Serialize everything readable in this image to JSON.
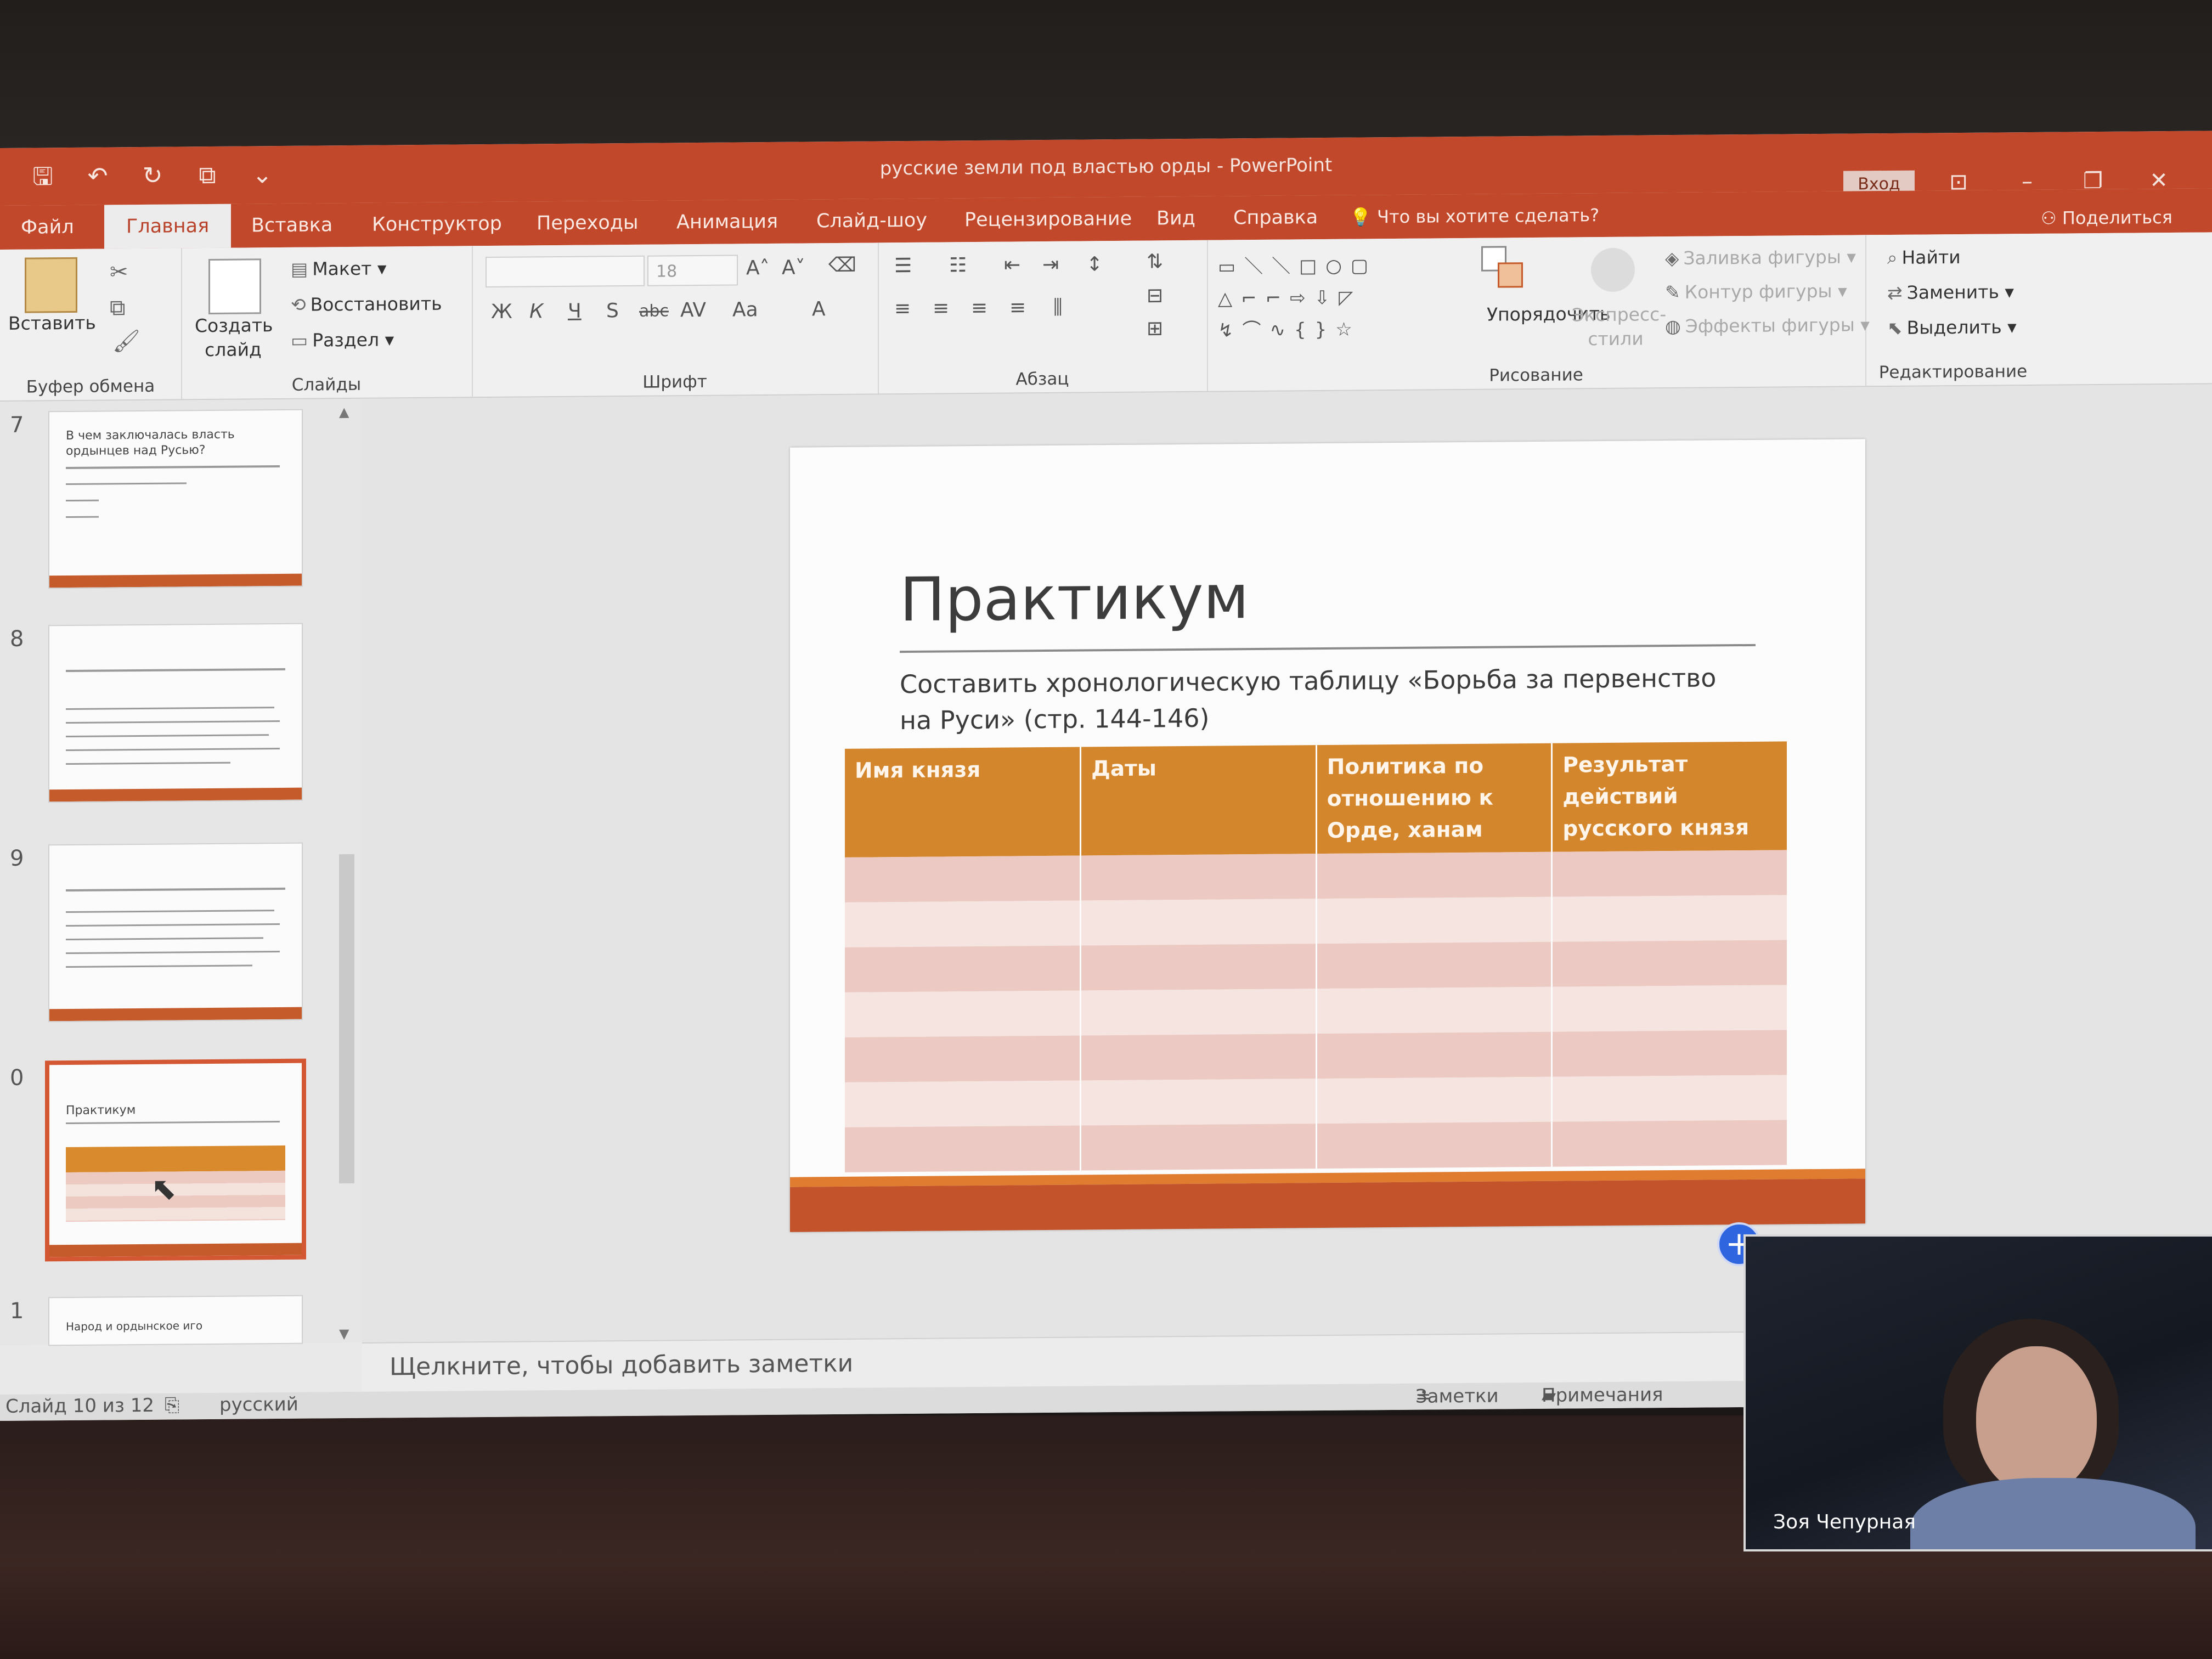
{
  "window": {
    "title": "русские земли под властью орды",
    "separator": "-",
    "app": "PowerPoint",
    "login": "Вход"
  },
  "qat": [
    "save-icon",
    "undo-icon",
    "redo-icon",
    "present-icon",
    "customize-icon"
  ],
  "tabs": [
    "Файл",
    "Главная",
    "Вставка",
    "Конструктор",
    "Переходы",
    "Анимация",
    "Слайд-шоу",
    "Рецензирование",
    "Вид",
    "Справка"
  ],
  "active_tab": "Главная",
  "tell_me": "Что вы хотите сделать?",
  "share": "Поделиться",
  "ribbon": {
    "clipboard": {
      "paste": "Вставить",
      "label": "Буфер обмена"
    },
    "slides": {
      "new_slide": "Создать слайд",
      "layout": "Макет",
      "reset": "Восстановить",
      "section": "Раздел",
      "label": "Слайды"
    },
    "font": {
      "font_name": "",
      "font_size": "18",
      "label": "Шрифт",
      "bold": "Ж",
      "italic": "К",
      "underline": "Ч",
      "shadow": "S",
      "strike": "abc",
      "spacing": "AV",
      "case": "Аа",
      "color": "A"
    },
    "paragraph": {
      "label": "Абзац"
    },
    "drawing": {
      "arrange": "Упорядочить",
      "quick_styles": "Экспресс-стили",
      "fill": "Заливка фигуры",
      "outline": "Контур фигуры",
      "effects": "Эффекты фигуры",
      "label": "Рисование"
    },
    "editing": {
      "find": "Найти",
      "replace": "Заменить",
      "select": "Выделить",
      "label": "Редактирование"
    }
  },
  "thumbnails": [
    {
      "num": "7",
      "title": "В чем заключалась власть ордынцев над Русью?"
    },
    {
      "num": "8",
      "title": ""
    },
    {
      "num": "9",
      "title": ""
    },
    {
      "num": "0",
      "title": "Практикум"
    },
    {
      "num": "1",
      "title": "Народ и ордынское иго"
    }
  ],
  "slide": {
    "title": "Практикум",
    "subtitle": "Составить хронологическую таблицу «Борьба за первенство на Руси» (стр. 144-146)",
    "table_headers": [
      "Имя князя",
      "Даты",
      "Политика по отношению к Орде, ханам",
      "Результат действий русского князя"
    ],
    "table_rows": 7
  },
  "notes_placeholder": "Щелкните, чтобы добавить заметки",
  "status": {
    "slide_counter": "Слайд 10 из 12",
    "language": "русский",
    "notes": "Заметки",
    "comments": "Примечания"
  },
  "video": {
    "name": "Зоя Чепурная"
  }
}
